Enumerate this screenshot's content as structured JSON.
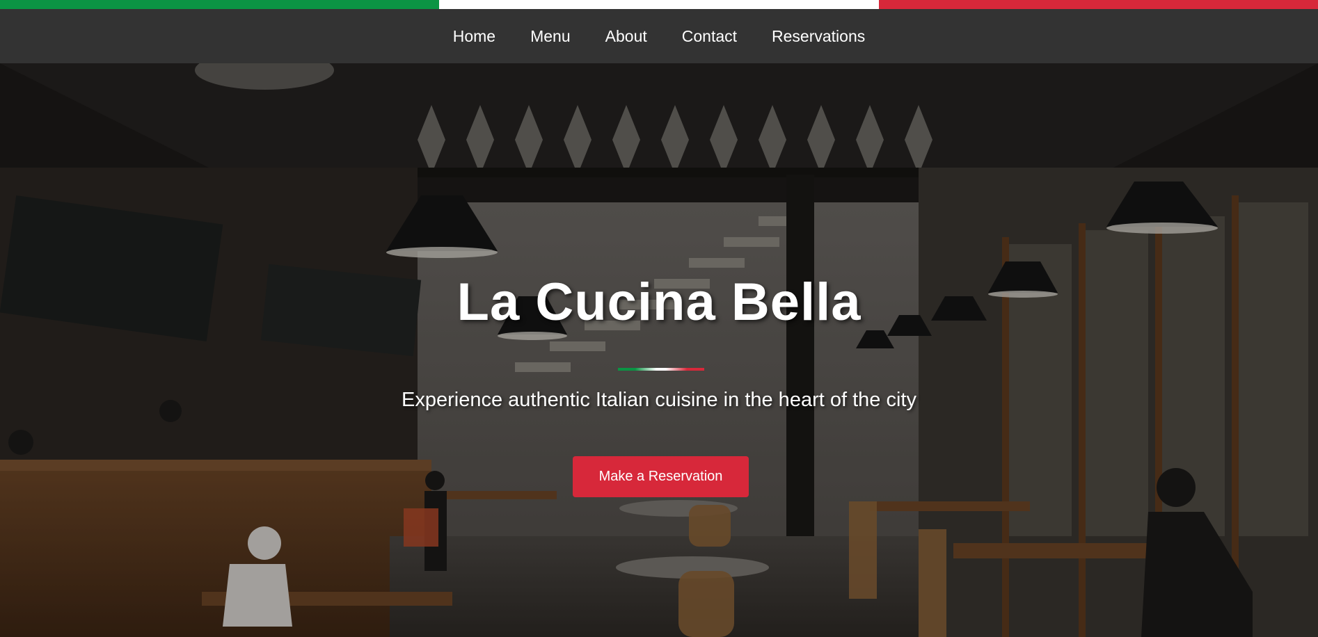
{
  "flag": {
    "colors": [
      "#0b9444",
      "#ffffff",
      "#d7283a"
    ]
  },
  "nav": {
    "items": [
      {
        "label": "Home"
      },
      {
        "label": "Menu"
      },
      {
        "label": "About"
      },
      {
        "label": "Contact"
      },
      {
        "label": "Reservations"
      }
    ]
  },
  "hero": {
    "image": "restaurant-interior-photo",
    "title": "La Cucina Bella",
    "subtitle": "Experience authentic Italian cuisine in the heart of the city",
    "cta_label": "Make a Reservation"
  },
  "colors": {
    "accent": "#d7283a",
    "nav_background": "#333333",
    "green": "#0b9444"
  }
}
